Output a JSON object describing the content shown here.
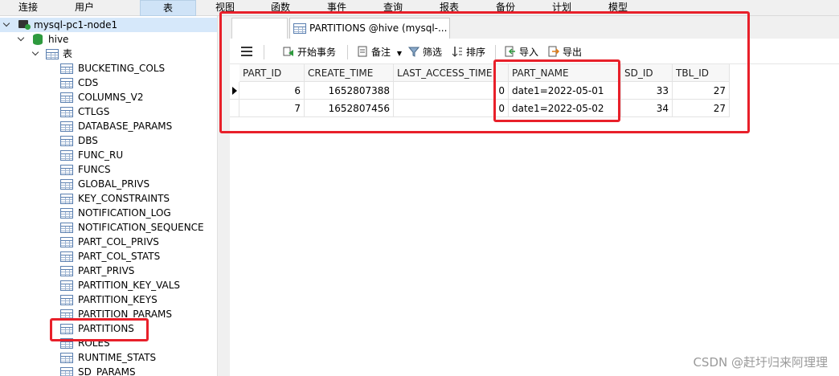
{
  "menu": [
    "连接",
    "用户",
    "表",
    "视图",
    "函数",
    "事件",
    "查询",
    "报表",
    "备份",
    "计划",
    "模型"
  ],
  "tree": {
    "connection": "mysql-pc1-node1",
    "database": "hive",
    "tables_node": "表",
    "tables": [
      "BUCKETING_COLS",
      "CDS",
      "COLUMNS_V2",
      "CTLGS",
      "DATABASE_PARAMS",
      "DBS",
      "FUNC_RU",
      "FUNCS",
      "GLOBAL_PRIVS",
      "KEY_CONSTRAINTS",
      "NOTIFICATION_LOG",
      "NOTIFICATION_SEQUENCE",
      "PART_COL_PRIVS",
      "PART_COL_STATS",
      "PART_PRIVS",
      "PARTITION_KEY_VALS",
      "PARTITION_KEYS",
      "PARTITION_PARAMS",
      "PARTITIONS",
      "ROLES",
      "RUNTIME_STATS",
      "SD_PARAMS"
    ]
  },
  "tab": {
    "title": "PARTITIONS @hive (mysql-..."
  },
  "toolbar": {
    "begin_tx": "开始事务",
    "memo": "备注",
    "filter": "筛选",
    "sort": "排序",
    "import": "导入",
    "export": "导出"
  },
  "grid": {
    "columns": [
      "PART_ID",
      "CREATE_TIME",
      "LAST_ACCESS_TIME",
      "PART_NAME",
      "SD_ID",
      "TBL_ID"
    ],
    "rows": [
      [
        "6",
        "1652807388",
        "0",
        "date1=2022-05-01",
        "33",
        "27"
      ],
      [
        "7",
        "1652807456",
        "0",
        "date1=2022-05-02",
        "34",
        "27"
      ]
    ]
  },
  "watermark": "CSDN @赶圩归来阿理理",
  "colors": {
    "annotation": "#e8202a",
    "active_menu": "#cfe3f7"
  },
  "icons": [
    "menu-icon",
    "begin-transaction-icon",
    "memo-icon",
    "filter-icon",
    "sort-icon",
    "import-icon",
    "export-icon",
    "table-icon",
    "database-icon",
    "connection-icon"
  ]
}
